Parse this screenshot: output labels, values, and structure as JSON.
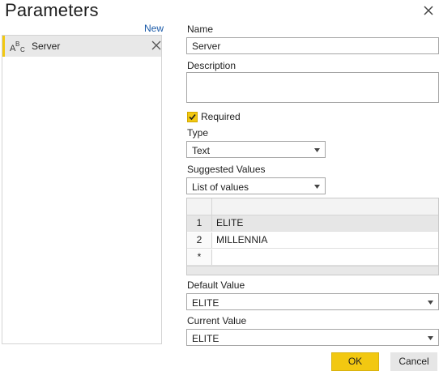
{
  "dialog": {
    "title": "Parameters",
    "new_label": "New"
  },
  "parameter_list": [
    {
      "label": "Server",
      "type_icon": "abc-text-icon"
    }
  ],
  "form": {
    "name_label": "Name",
    "name_value": "Server",
    "description_label": "Description",
    "description_value": "",
    "required_label": "Required",
    "required_checked": true,
    "type_label": "Type",
    "type_value": "Text",
    "suggested_values_label": "Suggested Values",
    "suggested_values_value": "List of values",
    "values_grid": {
      "rows": [
        {
          "index": "1",
          "value": "ELITE"
        },
        {
          "index": "2",
          "value": "MILLENNIA"
        },
        {
          "index": "*",
          "value": ""
        }
      ]
    },
    "default_value_label": "Default Value",
    "default_value": "ELITE",
    "current_value_label": "Current Value",
    "current_value": "ELITE"
  },
  "buttons": {
    "ok_label": "OK",
    "cancel_label": "Cancel"
  },
  "colors": {
    "accent": "#f2c811",
    "link": "#1a5aa8",
    "selected_row": "#e8e8e8"
  }
}
